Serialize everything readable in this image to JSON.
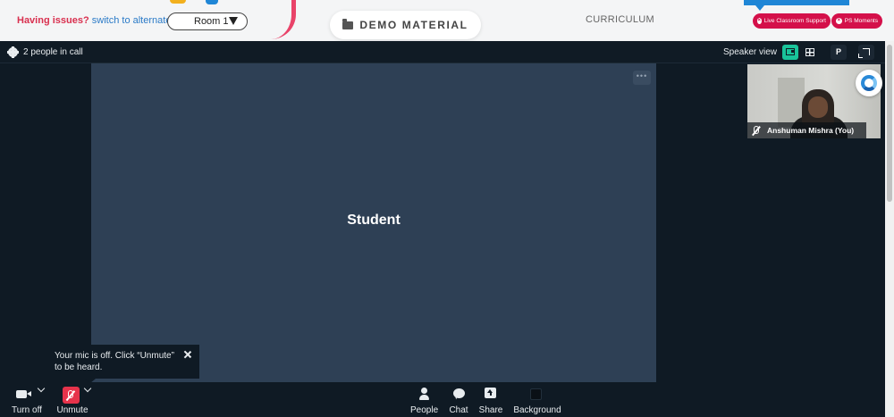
{
  "topbar": {
    "issues_text": "Having issues?",
    "switch_link": "switch to alternate room",
    "room_select_value": "Room 1",
    "demo_material_label": "DEMO MATERIAL",
    "curriculum_label": "CURRICULUM",
    "live_support_label": "Live Classroom Support",
    "ps_moments_label": "PS Moments"
  },
  "call": {
    "people_count_text": "2 people in call",
    "view_mode_label": "Speaker view",
    "p_button_label": "P",
    "main_participant": "Student",
    "more_options_glyph": "•••",
    "self_name": "Anshuman Mishra (You)"
  },
  "toast": {
    "message": "Your mic is off. Click “Unmute” to be heard."
  },
  "controls": {
    "video_label": "Turn off",
    "mic_label": "Unmute",
    "people_label": "People",
    "chat_label": "Chat",
    "share_label": "Share",
    "background_label": "Background"
  },
  "colors": {
    "accent_red": "#d4104a",
    "link_blue": "#2a7ac7",
    "call_bg": "#0f1a24",
    "tile_bg": "#2e4055",
    "active_view": "#19c39a",
    "mic_off_red": "#e6334b"
  },
  "icons": [
    "folder-icon",
    "gear-icon",
    "speaker-view-icon",
    "grid-view-icon",
    "expand-icon",
    "mic-off-icon",
    "camera-icon",
    "people-icon",
    "chat-icon",
    "share-icon",
    "background-icon",
    "close-icon",
    "chevron-down-icon"
  ]
}
